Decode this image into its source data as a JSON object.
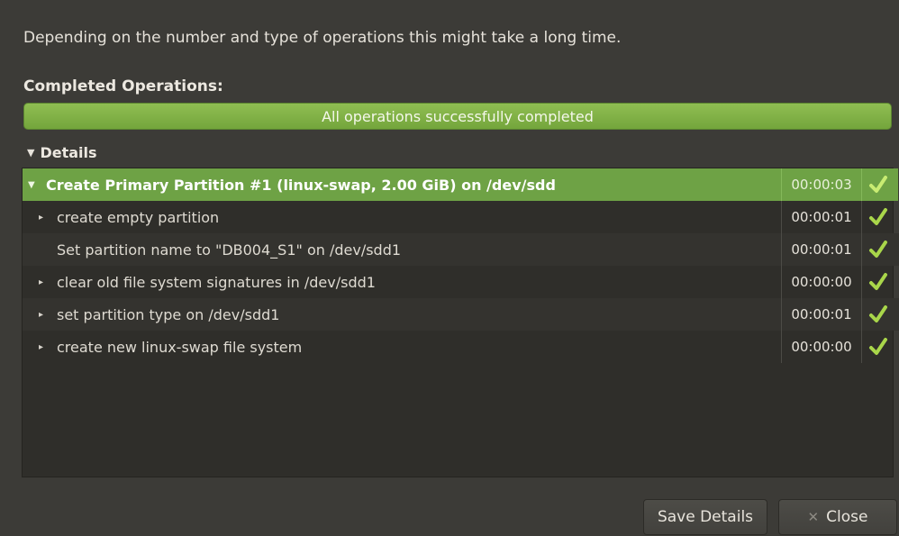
{
  "dialog": {
    "intro": "Depending on the number and type of operations this might take a long time.",
    "completed_label": "Completed Operations:",
    "progress": {
      "text": "All operations successfully completed",
      "fraction": 1.0,
      "color": "#7cb342"
    },
    "details_label": "Details"
  },
  "operations": [
    {
      "name": "Create Primary Partition #1 (linux-swap, 2.00 GiB) on /dev/sdd",
      "time": "00:00:03",
      "status": "check-icon",
      "expander": "▼"
    },
    {
      "name": "create empty partition",
      "time": "00:00:01",
      "status": "check-icon",
      "expander": "▸"
    },
    {
      "name": "Set partition name to \"DB004_S1\" on /dev/sdd1",
      "time": "00:00:01",
      "status": "check-icon",
      "expander": ""
    },
    {
      "name": "clear old file system signatures in /dev/sdd1",
      "time": "00:00:00",
      "status": "check-icon",
      "expander": "▸"
    },
    {
      "name": "set partition type on /dev/sdd1",
      "time": "00:00:01",
      "status": "check-icon",
      "expander": "▸"
    },
    {
      "name": "create new linux-swap file system",
      "time": "00:00:00",
      "status": "check-icon",
      "expander": "▸"
    }
  ],
  "buttons": {
    "save_label": "Save Details",
    "close_label": "Close"
  },
  "colors": {
    "accent": "#6ea245",
    "check": "#a9d64a"
  }
}
